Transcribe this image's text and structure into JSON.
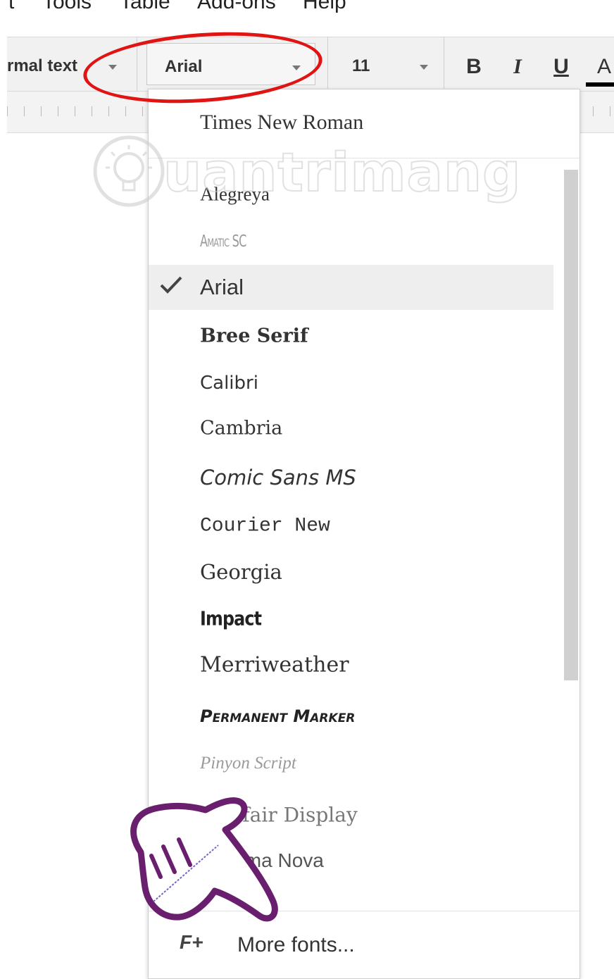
{
  "menu": {
    "items": [
      "t",
      "Tools",
      "Table",
      "Add-ons",
      "Help"
    ]
  },
  "toolbar": {
    "style_value": "rmal text",
    "font_value": "Arial",
    "size_value": "11",
    "bold_label": "B",
    "italic_label": "I",
    "underline_label": "U",
    "text_color_label": "A"
  },
  "font_menu": {
    "top_item": "Times New Roman",
    "items": [
      {
        "label": "Alegreya"
      },
      {
        "label": "Amatic SC"
      },
      {
        "label": "Arial",
        "selected": true
      },
      {
        "label": "Bree Serif"
      },
      {
        "label": "Calibri"
      },
      {
        "label": "Cambria"
      },
      {
        "label": "Comic Sans MS"
      },
      {
        "label": "Courier New"
      },
      {
        "label": "Georgia"
      },
      {
        "label": "Impact"
      },
      {
        "label": "Merriweather"
      },
      {
        "label": "Permanent Marker"
      },
      {
        "label": "Pinyon Script"
      },
      {
        "label": "Playfair Display"
      },
      {
        "label": "Proxima Nova"
      }
    ],
    "more_fonts_icon": "F+",
    "more_fonts_label": "More fonts..."
  },
  "watermark": {
    "text": "uantrimang"
  },
  "icons": {
    "check": "check-icon",
    "hand": "pointing-hand-icon",
    "watermark": "lightbulb-icon"
  },
  "colors": {
    "annotation": "#e11414",
    "hand_outline": "#6a1f6e"
  }
}
